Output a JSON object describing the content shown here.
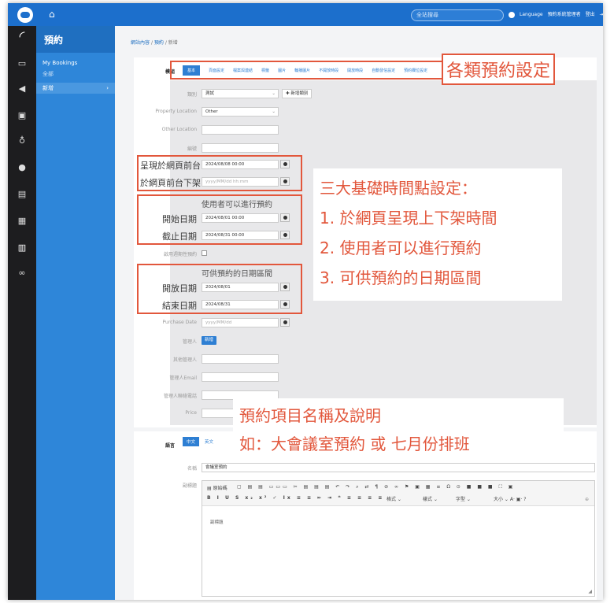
{
  "topbar": {
    "search_placeholder": "全站搜尋",
    "language_label": "Language",
    "user_label": "預約系統管理者",
    "logout_label": "登出"
  },
  "sidebar": {
    "title": "預約",
    "items": [
      {
        "label": "My Bookings"
      },
      {
        "label": "全部"
      },
      {
        "label": "新增"
      }
    ],
    "active_chevron": "›"
  },
  "breadcrumb": {
    "items": [
      "網站內容",
      "預約",
      "新增"
    ],
    "separator": "/"
  },
  "form": {
    "section_label": "模組",
    "tabs": [
      "基本",
      "頁面設定",
      "檔案與連結",
      "標籤",
      "圖片",
      "輪播圖片",
      "不開放時段",
      "開放時段",
      "自動發信設定",
      "預約欄位設定"
    ],
    "category_label": "類別",
    "category_value": "測試",
    "add_category_button": "✚ 新增類別",
    "property_location_label": "Property Location",
    "property_location_value": "Other",
    "other_location_label": "Other Location",
    "code_label": "編號",
    "publish_label": "呈現於網頁前台",
    "publish_value": "2024/08/08 00:00",
    "unpublish_label": "於網頁前台下架",
    "unpublish_placeholder": "yyyy/MM/dd hh:mm",
    "booking_group_title": "使用者可以進行預約",
    "booking_start_label": "開始日期",
    "booking_start_value": "2024/08/01 00:00",
    "booking_end_label": "截止日期",
    "booking_end_value": "2024/08/31 00:00",
    "periodic_label": "啟用週期性預約",
    "available_group_title": "可供預約的日期區間",
    "open_date_label": "開放日期",
    "open_date_value": "2024/08/01",
    "close_date_label": "結束日期",
    "close_date_value": "2024/08/31",
    "purchase_date_label": "Purchase Date",
    "purchase_date_placeholder": "yyyy/MM/dd",
    "manager_label": "管理人",
    "manager_button": "新增",
    "other_manager_label": "其他管理人",
    "manager_email_label": "管理人Email",
    "manager_phone_label": "管理人聯絡電話",
    "price_label": "Price"
  },
  "lang_section": {
    "label": "語言",
    "tabs": [
      "中文",
      "英文"
    ],
    "name_label": "名稱",
    "name_value": "會議室預約",
    "subtitle_label": "副標題",
    "editor_source_label": "原始碼",
    "editor_format_label": "樣式",
    "editor_paragraph_label": "格式",
    "editor_font_label": "字型",
    "editor_size_label": "大小",
    "editor_body_text": "副標題"
  },
  "callouts": {
    "settings_title": "各類預約設定",
    "time_title": "三大基礎時間點設定：",
    "time_items": [
      "1. 於網頁呈現上下架時間",
      "2. 使用者可以進行預約",
      "3. 可供預約的日期區間"
    ],
    "name_title": "預約項目名稱及說明",
    "name_example": "如：大會議室預約 或 七月份排班"
  },
  "colors": {
    "topbar": "#1c6fcc",
    "sidebar": "#2e86d9",
    "iconbar": "#1d1d1f",
    "accent": "#2e7fd3",
    "callout_red": "#e2573c"
  },
  "icons": [
    "home-icon",
    "globe-icon",
    "logout-icon",
    "calendar-icon",
    "chart-icon",
    "folder-icon",
    "bulb-icon",
    "help-icon",
    "stack-icon",
    "list-icon",
    "book-icon",
    "link-icon"
  ]
}
